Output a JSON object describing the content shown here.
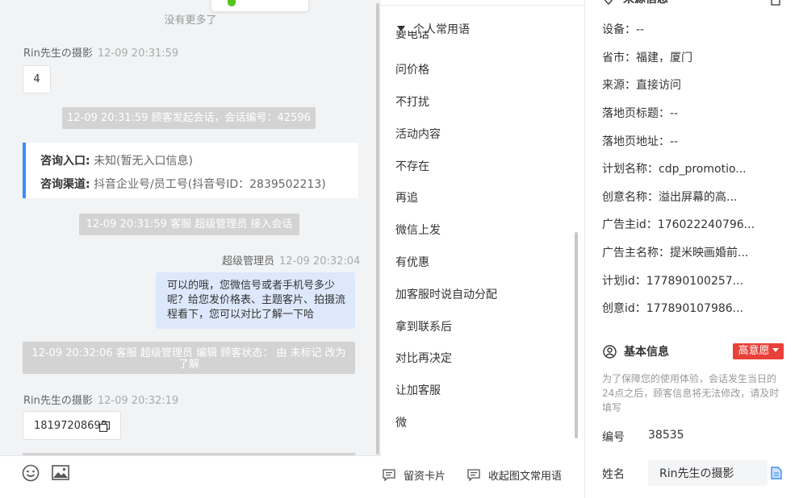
{
  "chat": {
    "no_more": "没有更多了",
    "messages": [
      {
        "sender": "Rin先生の摄影",
        "time": "12-09 20:31:59",
        "text": "4"
      },
      {
        "sender": "超级管理员",
        "time": "12-09 20:32:04",
        "text": "可以的哦，您微信号或者手机号多少呢？给您发价格表、主题客片、拍摄流程看下，您可以对比了解一下哈"
      },
      {
        "sender": "Rin先生の摄影",
        "time": "12-09 20:32:19",
        "text": "18197208693"
      }
    ],
    "system": [
      "12-09 20:31:59 顾客发起会话，会话编号：42596",
      "12-09 20:31:59 客服 超级管理员 接入会话",
      "12-09 20:32:06 客服 超级管理员 编辑 顾客状态： 由 未标记 改为 了解"
    ],
    "entry": {
      "label1": "咨询入口:",
      "value1": "未知(暂无入口信息)",
      "label2": "咨询渠道:",
      "value2": "抖音企业号/员工号(抖音号ID：2839502213)"
    }
  },
  "phrases": {
    "group_title": "个人常用语",
    "partial_item": "要电话",
    "items": [
      "问价格",
      "不打扰",
      "活动内容",
      "不存在",
      "再追",
      "微信上发",
      "有优惠",
      "加客服时说自动分配",
      "拿到联系后",
      "对比再决定",
      "让加客服",
      "微"
    ],
    "btn_card": "留资卡片",
    "btn_collapse": "收起图文常用语"
  },
  "source_info": {
    "title": "来源信息",
    "rows": [
      {
        "label": "设备：",
        "value": "--"
      },
      {
        "label": "省市：",
        "value": "福建，厦门"
      },
      {
        "label": "来源：",
        "value": "直接访问"
      },
      {
        "label": "落地页标题：",
        "value": "--"
      },
      {
        "label": "落地页地址：",
        "value": "--"
      },
      {
        "label": "计划名称：",
        "value": "cdp_promotio..."
      },
      {
        "label": "创意名称：",
        "value": "溢出屏幕的高..."
      },
      {
        "label": "广告主id：",
        "value": "176022240796..."
      },
      {
        "label": "广告主名称：",
        "value": "提米映画婚前..."
      },
      {
        "label": "计划id：",
        "value": "177890100257..."
      },
      {
        "label": "创意id：",
        "value": "177890107986..."
      }
    ]
  },
  "basic_info": {
    "title": "基本信息",
    "badge": "高意愿",
    "notice": "为了保障您的使用体验，会话发生当日的24点之后，顾客信息将无法修改，请及时填写",
    "number_label": "编号",
    "number_value": "38535",
    "name_label": "姓名",
    "name_value": "Rin先生の摄影"
  },
  "colors": {
    "accent": "#3a8ef6",
    "badge": "#e8413a",
    "my_bubble": "#dde8fc"
  }
}
